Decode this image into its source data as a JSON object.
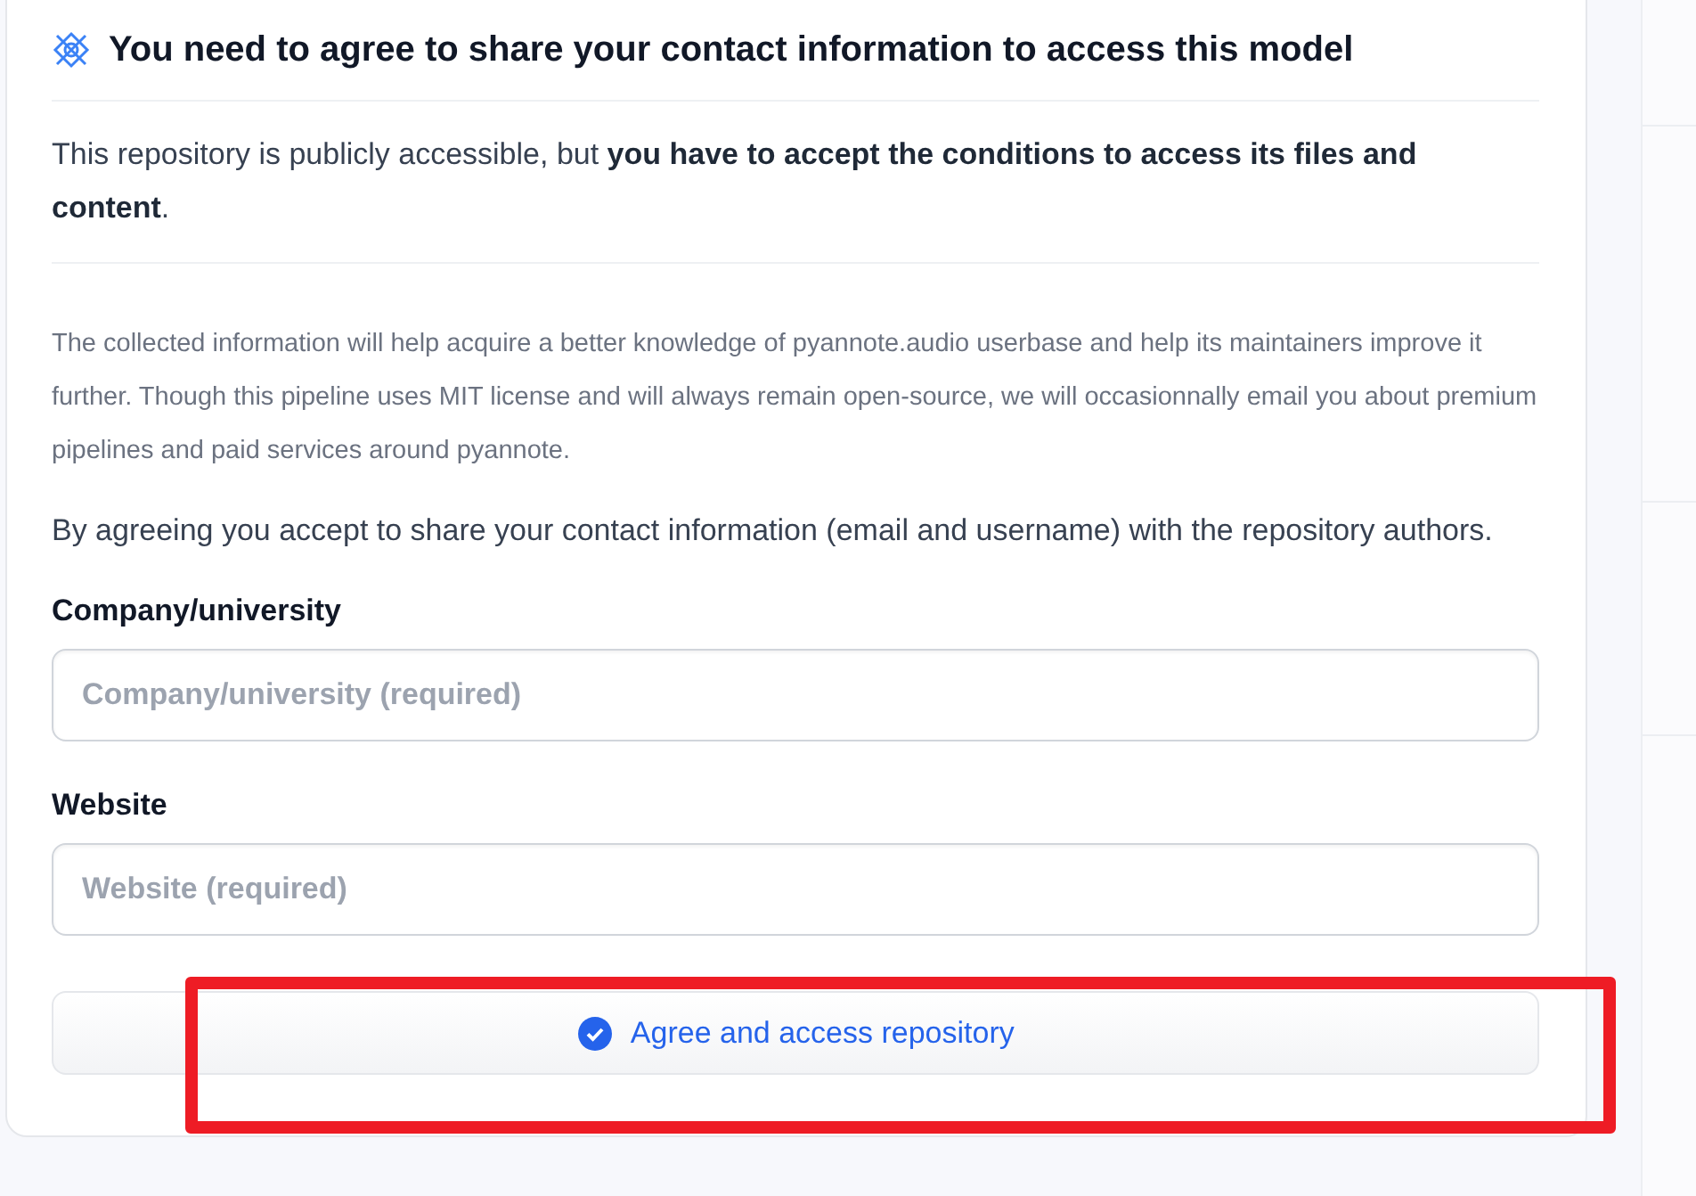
{
  "gate": {
    "title": "You need to agree to share your contact information to access this model",
    "notice": "This repository is publicly accessible, but **you have to accept the conditions to access its files and content**.",
    "description": "The collected information will help acquire a better knowledge of pyannote.audio userbase and help its maintainers improve it further. Though this pipeline uses MIT license and will always remain open-source, we will occasionnally email you about premium pipelines and paid services around pyannote.",
    "consent": "By agreeing you accept to share your contact information (email and username) with the repository authors.",
    "fields": [
      {
        "label": "Company/university",
        "placeholder": "Company/university (required)"
      },
      {
        "label": "Website",
        "placeholder": "Website (required)"
      }
    ],
    "submit": "Agree and access repository"
  }
}
